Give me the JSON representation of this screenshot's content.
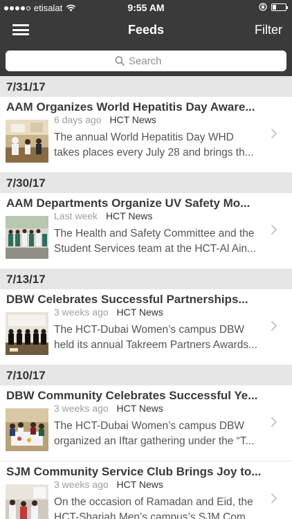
{
  "status_bar": {
    "carrier": "etisalat",
    "time": "9:55 AM",
    "signal_bars_filled": 4,
    "signal_bars_total": 5,
    "battery_level": 0.25
  },
  "nav": {
    "title": "Feeds",
    "filter_label": "Filter"
  },
  "search": {
    "placeholder": "Search"
  },
  "sections": [
    {
      "date": "7/31/17",
      "items": [
        {
          "title": "AAM Organizes World Hepatitis Day Aware...",
          "time_ago": "6 days ago",
          "source": "HCT News",
          "excerpt": "The annual World Hepatitis Day WHD takes places every July 28 and brings th..."
        }
      ]
    },
    {
      "date": "7/30/17",
      "items": [
        {
          "title": "AAM Departments Organize UV Safety Mo...",
          "time_ago": "Last week",
          "source": "HCT News",
          "excerpt": "The Health and Safety Committee and the Student Services team at the HCT-Al Ain..."
        }
      ]
    },
    {
      "date": "7/13/17",
      "items": [
        {
          "title": "DBW Celebrates Successful Partnerships...",
          "time_ago": "3 weeks ago",
          "source": "HCT News",
          "excerpt": " The HCT-Dubai Women’s campus DBW held its annual Takreem Partners Awards..."
        }
      ]
    },
    {
      "date": "7/10/17",
      "items": [
        {
          "title": "DBW Community Celebrates Successful Ye...",
          "time_ago": "3 weeks ago",
          "source": "HCT News",
          "excerpt": "The HCT-Dubai Women’s campus DBW organized an Iftar gathering under the “T..."
        },
        {
          "title": "SJM Community Service Club Brings Joy to...",
          "time_ago": "3 weeks ago",
          "source": "HCT News",
          "excerpt": "On the occasion of Ramadan and Eid, the HCT-Sharjah Men’s campus’s SJM Com..."
        }
      ]
    }
  ],
  "colors": {
    "nav_background": "#3a3a3a",
    "section_background": "#e6e6e6",
    "title_text": "#3a3a3a",
    "meta_gray": "#a0a0a0"
  }
}
